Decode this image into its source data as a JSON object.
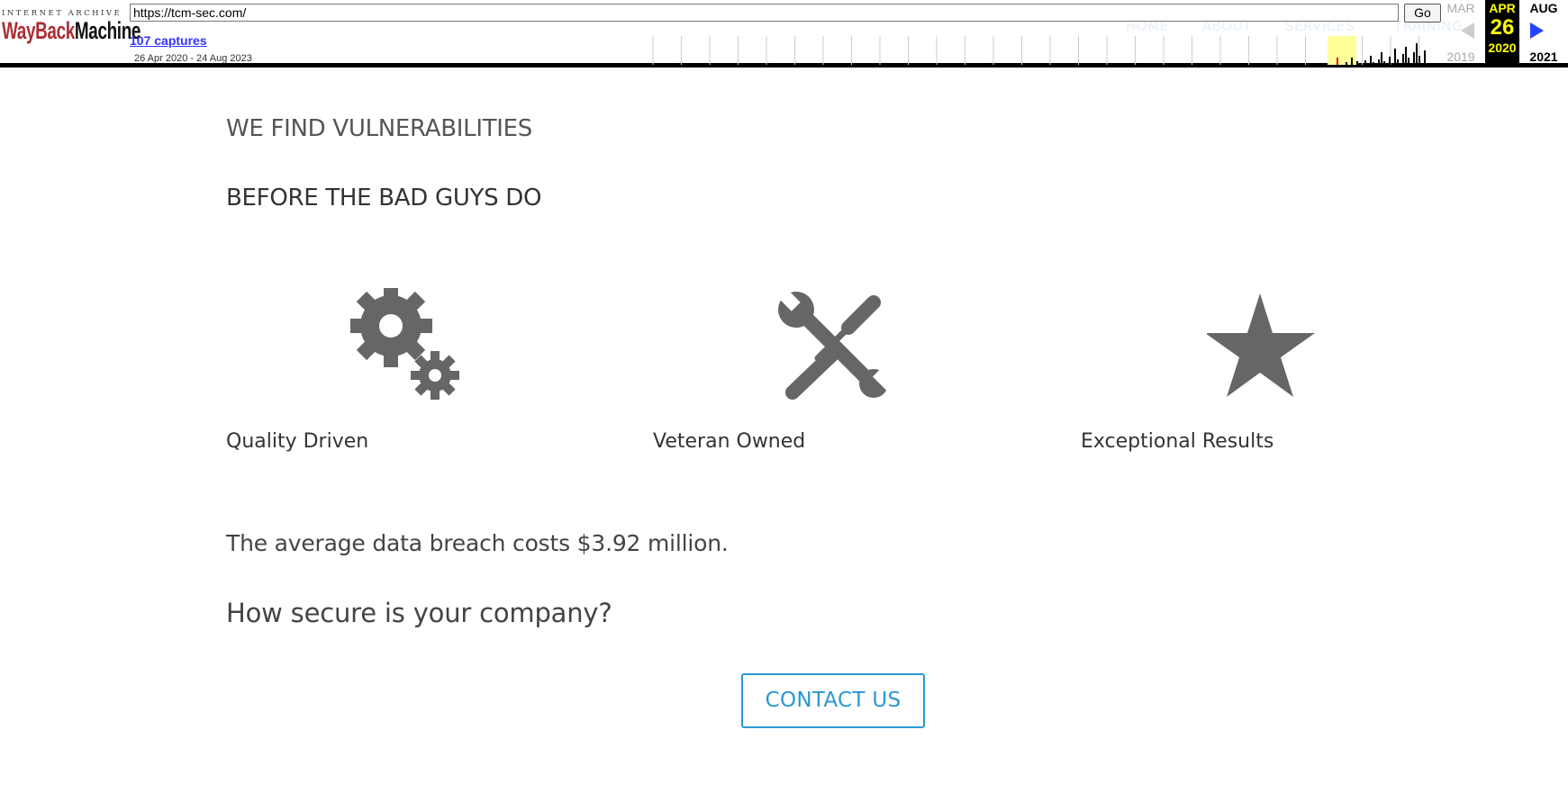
{
  "wayback": {
    "logo_top": "INTERNET ARCHIVE",
    "logo_word1": "WayBack",
    "logo_word2": "Machine",
    "url": "https://tcm-sec.com/",
    "go_label": "Go",
    "captures": "107 captures",
    "range": "26 Apr 2020 - 24 Aug 2023",
    "prev_month": "MAR",
    "prev_year": "2019",
    "current_month": "APR",
    "current_day": "26",
    "current_year": "2020",
    "next_month": "AUG",
    "next_year": "2021",
    "colors": {
      "highlight": "#ffff00",
      "brand_red": "#ab2e33",
      "link": "#3333ff"
    }
  },
  "site_nav": [
    "HOME",
    "ABOUT",
    "SERVICES",
    "TRAINING"
  ],
  "hero": {
    "line1": "WE FIND VULNERABILITIES",
    "line2": "BEFORE THE BAD GUYS DO"
  },
  "features": [
    {
      "icon": "gears-icon",
      "label": "Quality Driven"
    },
    {
      "icon": "tools-icon",
      "label": "Veteran Owned"
    },
    {
      "icon": "star-icon",
      "label": "Exceptional Results"
    }
  ],
  "stats": {
    "breach_text": "The average data breach costs $3.92 million.",
    "question": "How secure is your company?"
  },
  "cta": {
    "label": "CONTACT US",
    "color": "#2a97d5"
  }
}
